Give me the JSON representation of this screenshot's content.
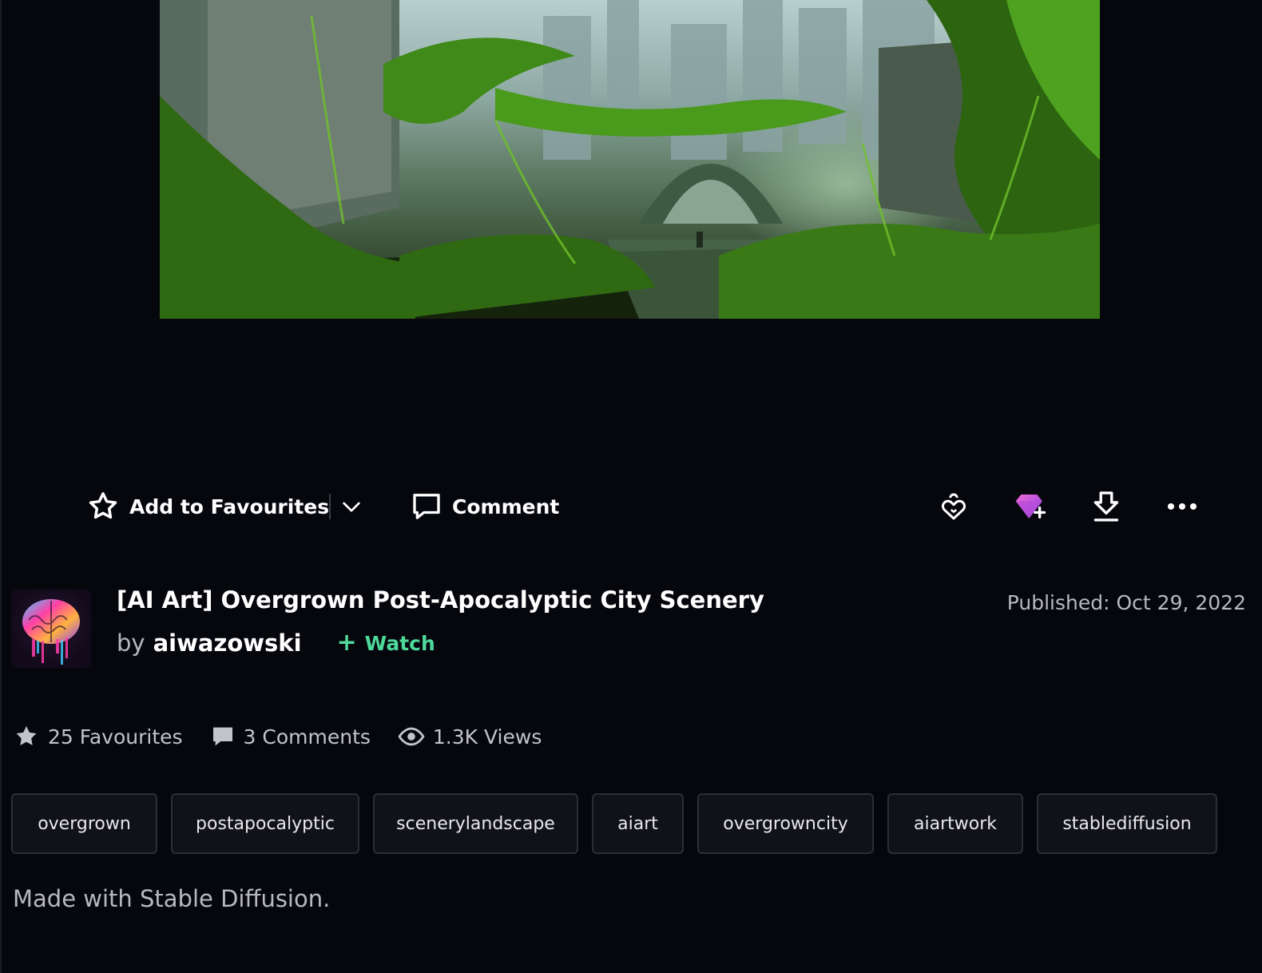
{
  "actions": {
    "favourite_label": "Add to Favourites",
    "comment_label": "Comment"
  },
  "deviation": {
    "title": "[AI Art] Overgrown Post-Apocalyptic City Scenery",
    "by_prefix": "by",
    "author": "aiwazowski",
    "watch_label": "Watch",
    "published": "Published: Oct 29, 2022"
  },
  "stats": {
    "favourites": "25 Favourites",
    "comments": "3 Comments",
    "views": "1.3K Views"
  },
  "tags": [
    "overgrown",
    "postapocalyptic",
    "scenerylandscape",
    "aiart",
    "overgrowncity",
    "aiartwork",
    "stablediffusion"
  ],
  "description": "Made with Stable Diffusion.",
  "colors": {
    "background": "#06070d",
    "watch_accent": "#4ed99a",
    "gem_accent": "#d957e8"
  },
  "icons": {
    "favourite": "star-outline-icon",
    "dropdown": "chevron-down-icon",
    "comment": "speech-bubble-icon",
    "badge": "heart-lock-icon",
    "core": "gem-plus-icon",
    "download": "download-icon",
    "more": "more-dots-icon"
  }
}
